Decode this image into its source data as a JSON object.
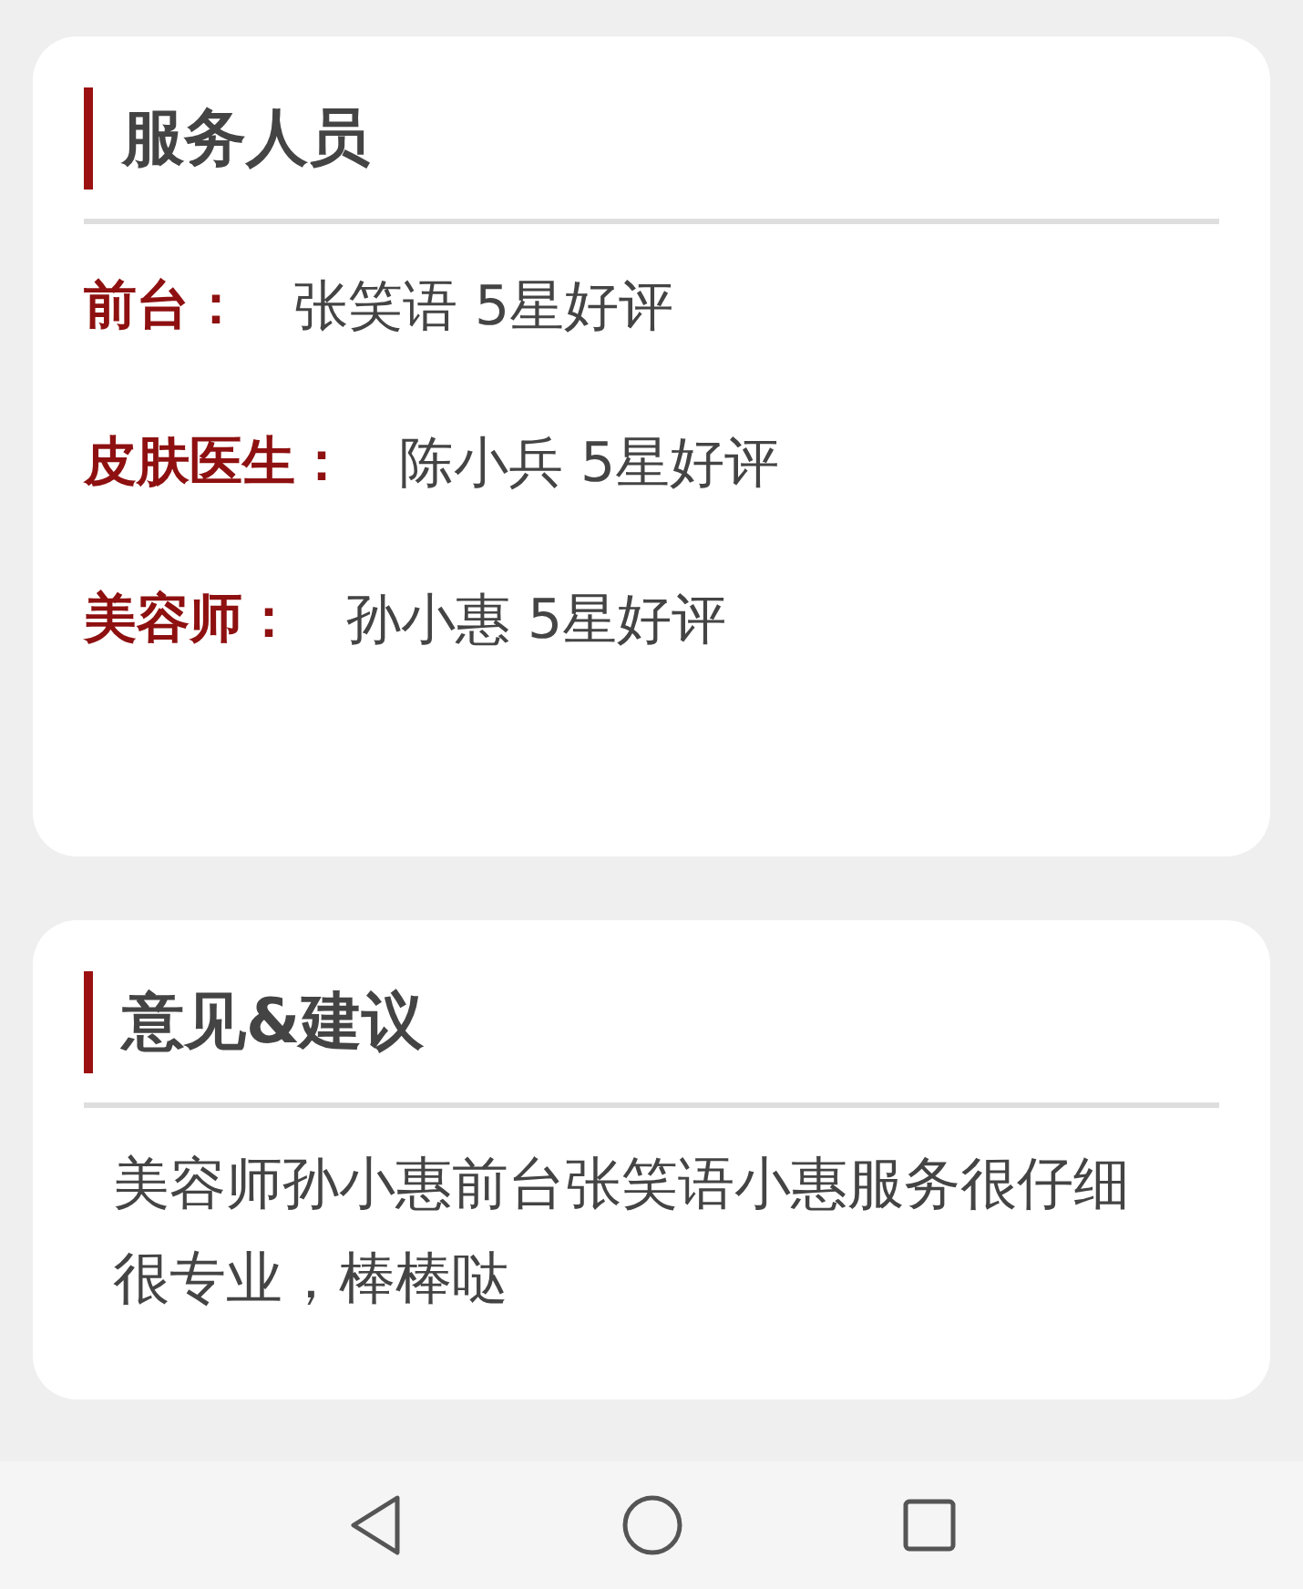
{
  "staff_card": {
    "title": "服务人员",
    "rows": [
      {
        "label": "前台：",
        "value": "张笑语 5星好评"
      },
      {
        "label": "皮肤医生：",
        "value": "陈小兵 5星好评"
      },
      {
        "label": "美容师：",
        "value": "孙小惠 5星好评"
      }
    ]
  },
  "feedback_card": {
    "title": "意见&建议",
    "text": "美容师孙小惠前台张笑语小惠服务很仔细很专业，棒棒哒"
  },
  "nav_bar": {
    "buttons": [
      {
        "kind": "back"
      },
      {
        "kind": "home"
      },
      {
        "kind": "recents"
      }
    ]
  }
}
